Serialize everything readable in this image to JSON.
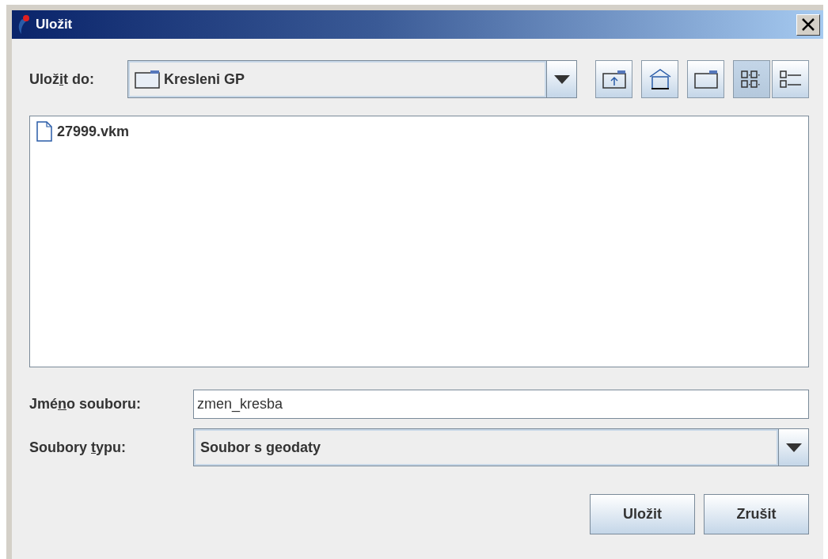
{
  "window": {
    "title": "Uložit"
  },
  "save_in": {
    "label": {
      "before": "Ulož",
      "key": "i",
      "after": "t do:"
    },
    "value": "Kresleni GP"
  },
  "tools": [
    {
      "kind": "up-folder"
    },
    {
      "kind": "home"
    },
    {
      "kind": "new-folder"
    }
  ],
  "view_modes": [
    {
      "kind": "list",
      "selected": true
    },
    {
      "kind": "details",
      "selected": false
    }
  ],
  "files": [
    {
      "name": "27999.vkm"
    }
  ],
  "file_name": {
    "label": {
      "before": "Jmé",
      "key": "n",
      "after": "o souboru:"
    },
    "value": "zmen_kresba"
  },
  "file_type": {
    "label": {
      "before": "Soubory ",
      "key": "t",
      "after": "ypu:"
    },
    "value": "Soubor s geodaty"
  },
  "buttons": [
    {
      "label": "Uložit"
    },
    {
      "label": "Zrušit"
    }
  ]
}
